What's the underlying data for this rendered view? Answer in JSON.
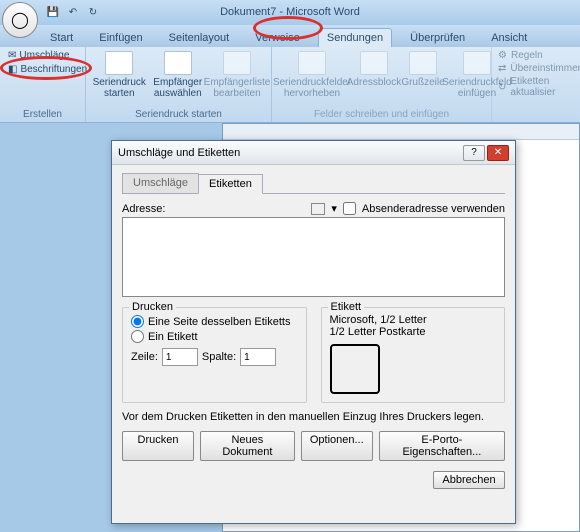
{
  "titlebar": {
    "title": "Dokument7 - Microsoft Word"
  },
  "tabs": [
    "Start",
    "Einfügen",
    "Seitenlayout",
    "Verweise",
    "Sendungen",
    "Überprüfen",
    "Ansicht"
  ],
  "activeTab": 4,
  "ribbon": {
    "erstellen": {
      "umschlage": "Umschläge",
      "beschriftungen": "Beschriftungen",
      "label": "Erstellen"
    },
    "seriendruck": {
      "starten": "Seriendruck starten",
      "empfanger": "Empfänger auswählen",
      "liste": "Empfängerliste bearbeiten",
      "label": "Seriendruck starten"
    },
    "felder": {
      "hervorheben": "Seriendruckfelder hervorheben",
      "adressblock": "Adressblock",
      "grusszeile": "Grußzeile",
      "einfugen": "Seriendruckfeld einfügen",
      "label": "Felder schreiben und einfügen"
    },
    "right": {
      "regeln": "Regeln",
      "ubereinstimmende": "Übereinstimmende",
      "etiketten": "Etiketten aktualisier"
    }
  },
  "dialog": {
    "title": "Umschläge und Etiketten",
    "tab_umschlage": "Umschläge",
    "tab_etiketten": "Etiketten",
    "adresse_label": "Adresse:",
    "absender": "Absenderadresse verwenden",
    "drucken_label": "Drucken",
    "radio1": "Eine Seite desselben Etiketts",
    "radio2": "Ein Etikett",
    "zeile": "Zeile:",
    "zeile_val": "1",
    "spalte": "Spalte:",
    "spalte_val": "1",
    "etikett_label": "Etikett",
    "et_line1": "Microsoft, 1/2 Letter",
    "et_line2": "1/2 Letter Postkarte",
    "note": "Vor dem Drucken Etiketten in den manuellen Einzug Ihres Druckers legen.",
    "btn_drucken": "Drucken",
    "btn_neues": "Neues Dokument",
    "btn_optionen": "Optionen...",
    "btn_eporto": "E-Porto-Eigenschaften...",
    "btn_abbrechen": "Abbrechen"
  }
}
